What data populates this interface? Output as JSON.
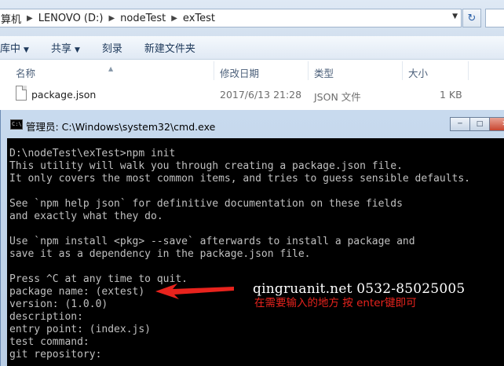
{
  "explorer": {
    "breadcrumb": [
      "算机",
      "LENOVO (D:)",
      "nodeTest",
      "exTest"
    ],
    "toolbar": {
      "library": "库中",
      "share": "共享",
      "burn": "刻录",
      "new_folder": "新建文件夹"
    },
    "columns": {
      "name": "名称",
      "modified": "修改日期",
      "type": "类型",
      "size": "大小"
    },
    "files": [
      {
        "name": "package.json",
        "modified": "2017/6/13 21:28",
        "type": "JSON 文件",
        "size": "1 KB"
      }
    ]
  },
  "cmd": {
    "title": "管理员: C:\\Windows\\system32\\cmd.exe",
    "icon_text": "C:\\",
    "lines": [
      "D:\\nodeTest\\exTest>npm init",
      "This utility will walk you through creating a package.json file.",
      "It only covers the most common items, and tries to guess sensible defaults.",
      "",
      "See `npm help json` for definitive documentation on these fields",
      "and exactly what they do.",
      "",
      "Use `npm install <pkg> --save` afterwards to install a package and",
      "save it as a dependency in the package.json file.",
      "",
      "Press ^C at any time to quit.",
      "package name: (extest)",
      "version: (1.0.0)",
      "description:",
      "entry point: (index.js)",
      "test command:",
      "git repository:"
    ]
  },
  "annotation": {
    "site": "qingruanit.net 0532-85025005",
    "tip": "在需要输入的地方 按  enter键即可",
    "color": "#e8231d"
  }
}
